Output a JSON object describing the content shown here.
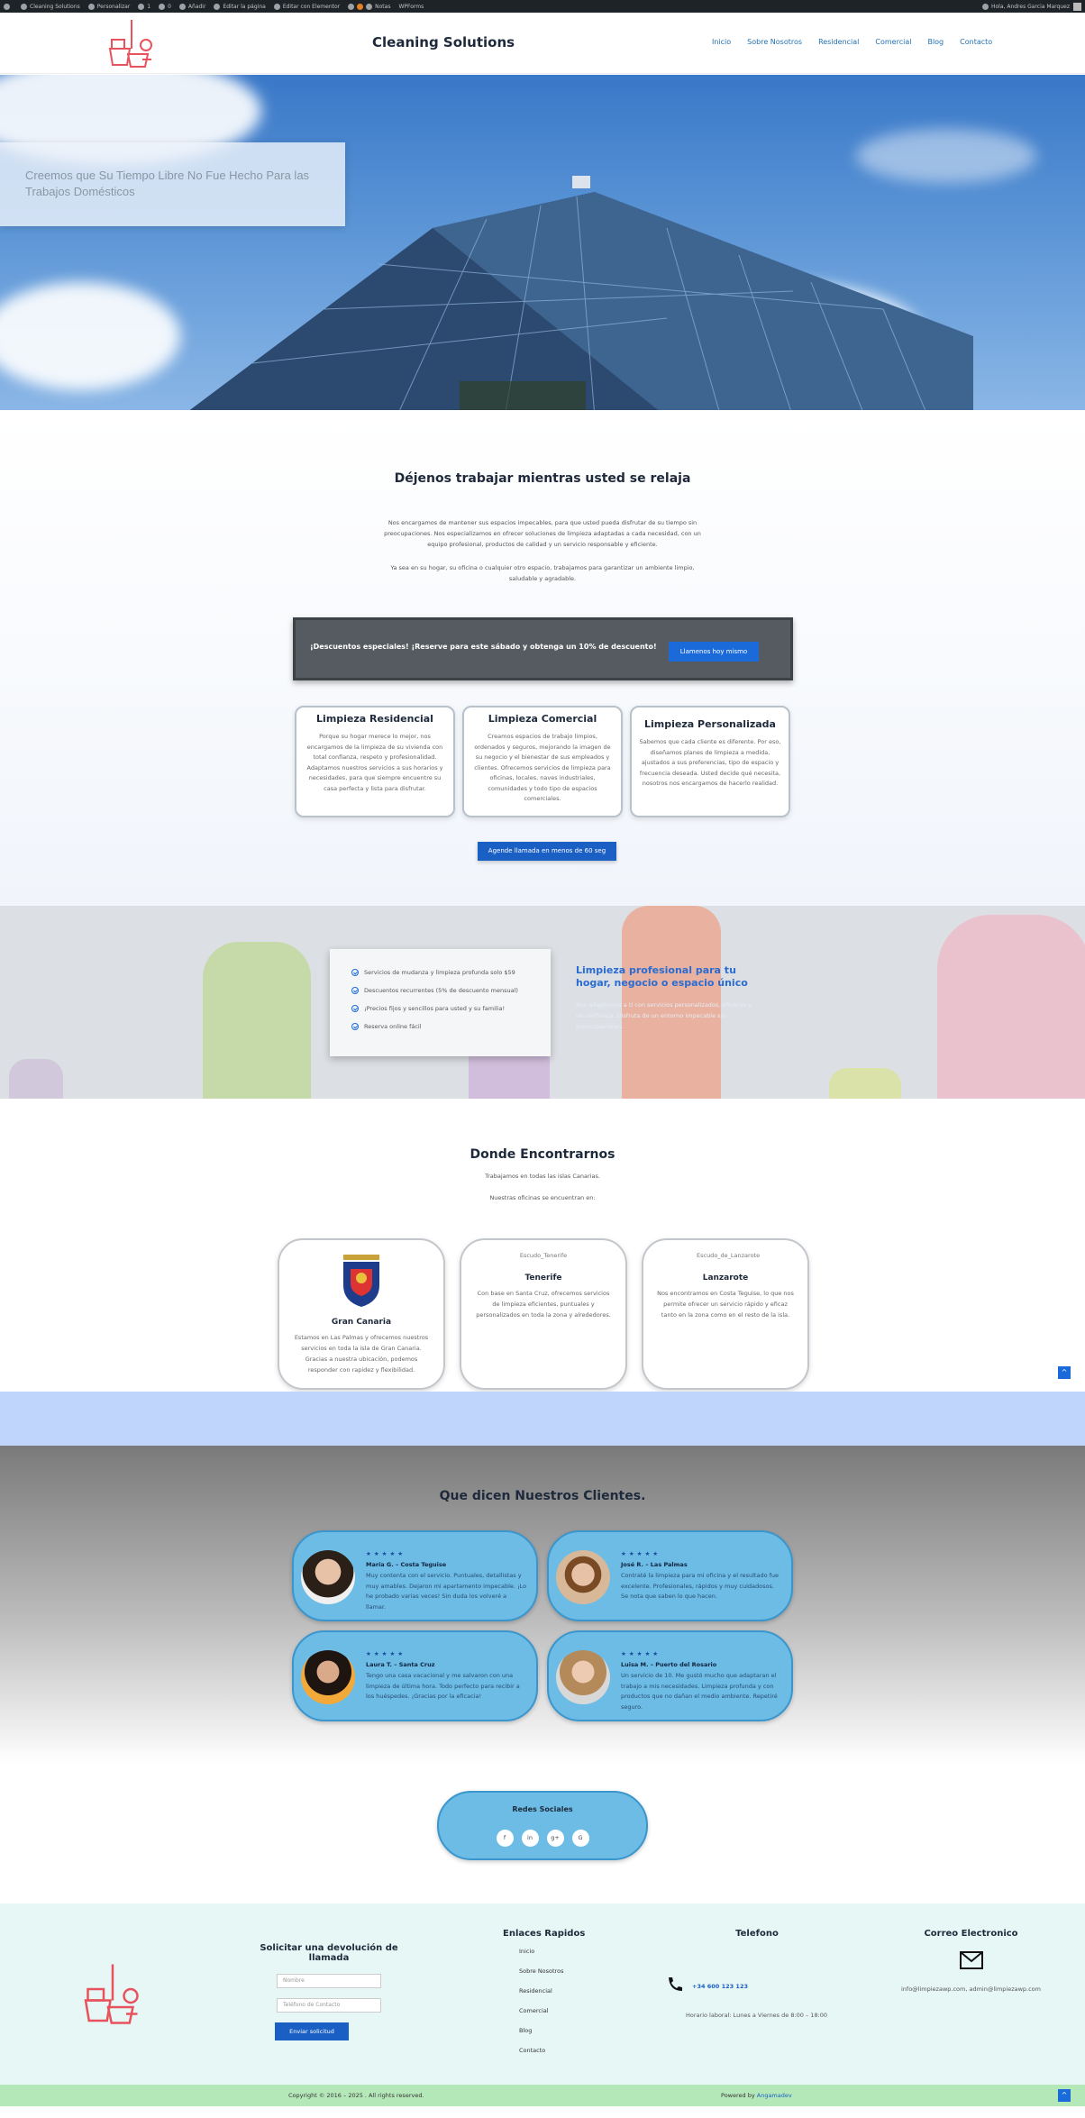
{
  "admin_bar": {
    "items": [
      "Cleaning Solutions",
      "Personalizar",
      "1",
      "0",
      "Añadir",
      "Editar la página",
      "Editar con Elementor",
      "Notas",
      "WPForms"
    ],
    "greeting": "Hola, Andres Garcia Marquez"
  },
  "header": {
    "site_title": "Cleaning Solutions",
    "nav": [
      "Inicio",
      "Sobre Nosotros",
      "Residencial",
      "Comercial",
      "Blog",
      "Contacto"
    ],
    "brand_color": "#e8525c"
  },
  "hero": {
    "headline": "Creemos que Su Tiempo Libre No Fue Hecho Para las Trabajos Domésticos"
  },
  "relax": {
    "title": "Déjenos trabajar mientras usted se relaja",
    "paragraph1": "Nos encargamos de mantener sus espacios impecables, para que usted pueda disfrutar de su tiempo sin preocupaciones. Nos especializamos en ofrecer soluciones de limpieza adaptadas a cada necesidad, con un equipo profesional, productos de calidad y un servicio responsable y eficiente.",
    "paragraph2": "Ya sea en su hogar, su oficina o cualquier otro espacio, trabajamos para garantizar un ambiente limpio, saludable y agradable.",
    "promo_text": "¡Descuentos especiales! ¡Reserve para este sábado y obtenga un 10% de descuento!",
    "promo_button": "Llamenos hoy mismo",
    "services": [
      {
        "title": "Limpieza Residencial",
        "text": "Porque su hogar merece lo mejor, nos encargamos de la limpieza de su vivienda con total confianza, respeto y profesionalidad. Adaptamos nuestros servicios a sus horarios y necesidades, para que siempre encuentre su casa perfecta y lista para disfrutar."
      },
      {
        "title": "Limpieza Comercial",
        "text": "Creamos espacios de trabajo limpios, ordenados y seguros, mejorando la imagen de su negocio y el bienestar de sus empleados y clientes. Ofrecemos servicios de limpieza para oficinas, locales, naves industriales, comunidades y todo tipo de espacios comerciales."
      },
      {
        "title": "Limpieza Personalizada",
        "text": "Sabemos que cada cliente es diferente. Por eso, diseñamos planes de limpieza a medida, ajustados a sus preferencias, tipo de espacio y frecuencia deseada. Usted decide qué necesita, nosotros nos encargamos de hacerlo realidad."
      }
    ],
    "schedule_button": "Agende llamada en menos de 60 seg"
  },
  "features": {
    "items": [
      "Servicios de mudanza y limpieza profunda solo $59",
      "Descuentos recurrentes (5% de descuento mensual)",
      "¡Precios fijos y sencillos para usted y su familia!",
      "Reserva online fácil"
    ],
    "title": "Limpieza profesional para tu hogar, negocio o espacio único",
    "text": "Nos adaptamos a ti con servicios personalizados, eficaces y de confianza. Disfruta de un entorno impecable sin preocupaciones."
  },
  "locations": {
    "title": "Donde Encontrarnos",
    "line1": "Trabajamos en todas las islas Canarias.",
    "line2": "Nuestras oficinas se encuentran en:",
    "cards": [
      {
        "name": "Gran Canaria",
        "img_alt": "",
        "text": "Estamos en Las Palmas y ofrecemos nuestros servicios en toda la isla de Gran Canaria. Gracias a nuestra ubicación, podemos responder con rapidez y flexibilidad."
      },
      {
        "name": "Tenerife",
        "img_alt": "Escudo_Tenerife",
        "text": "Con base en Santa Cruz, ofrecemos servicios de limpieza eficientes, puntuales y personalizados en toda la zona y alrededores."
      },
      {
        "name": "Lanzarote",
        "img_alt": "Escudo_de_Lanzarote",
        "text": "Nos encontramos en Costa Teguise, lo que nos permite ofrecer un servicio rápido y eficaz tanto en la zona como en el resto de la isla."
      }
    ]
  },
  "testimonials": {
    "title": "Que dicen Nuestros Clientes.",
    "stars": "★★★★★",
    "items": [
      {
        "name": "María G. – Costa Teguise",
        "text": "Muy contenta con el servicio. Puntuales, detallistas y muy amables. Dejaron mi apartamento impecable. ¡Lo he probado varias veces! Sin duda los volveré a llamar."
      },
      {
        "name": "José R. – Las Palmas",
        "text": "Contraté la limpieza para mi oficina y el resultado fue excelente. Profesionales, rápidos y muy cuidadosos. Se nota que saben lo que hacen."
      },
      {
        "name": "Laura T. – Santa Cruz",
        "text": "Tengo una casa vacacional y me salvaron con una limpieza de última hora. Todo perfecto para recibir a los huéspedes. ¡Gracias por la eficacia!"
      },
      {
        "name": "Luisa M. – Puerto del Rosario",
        "text": "Un servicio de 10. Me gustó mucho que adaptaran el trabajo a mis necesidades. Limpieza profunda y con productos que no dañan el medio ambiente. Repetiré seguro."
      }
    ]
  },
  "social": {
    "title": "Redes Sociales",
    "icons": [
      "f",
      "in",
      "g+",
      "G"
    ]
  },
  "footer": {
    "callback_title": "Solicitar una devolución de llamada",
    "name_placeholder": "Nombre",
    "phone_placeholder": "Teléfono de Contacto",
    "submit": "Enviar solicitud",
    "links_title": "Enlaces Rapidos",
    "links": [
      "Inicio",
      "Sobre Nosotros",
      "Residencial",
      "Comercial",
      "Blog",
      "Contacto"
    ],
    "phone_title": "Telefono",
    "phone": "+34 600 123 123",
    "hours": "Horario laboral: Lunes a Viernes de 8:00 – 18:00",
    "email_title": "Correo Electronico",
    "email": "info@limpiezawp.com, admin@limpiezawp.com"
  },
  "copyright": {
    "left": "Copyright © 2016 – 2025 . All rights reserved.",
    "powered_prefix": "Powered by ",
    "powered_link": "Angamadev"
  }
}
